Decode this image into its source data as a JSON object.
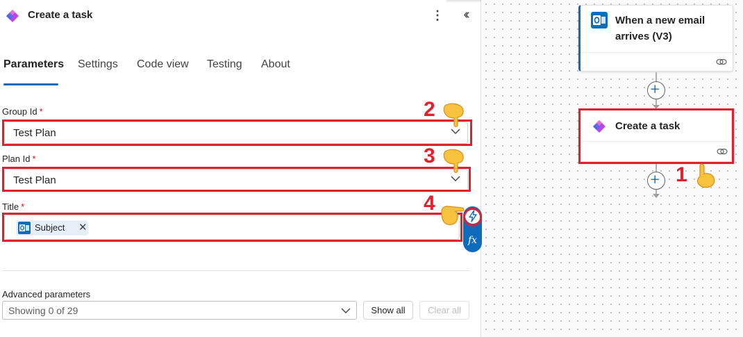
{
  "panel": {
    "title": "Create a task",
    "more_icon": "more-vertical-icon",
    "collapse_icon": "double-chevron-left-icon",
    "tabs": [
      {
        "label": "Parameters",
        "active": true
      },
      {
        "label": "Settings",
        "active": false
      },
      {
        "label": "Code view",
        "active": false
      },
      {
        "label": "Testing",
        "active": false
      },
      {
        "label": "About",
        "active": false
      }
    ],
    "fields": {
      "group_id": {
        "label": "Group Id",
        "required_mark": "*",
        "value": "Test Plan"
      },
      "plan_id": {
        "label": "Plan Id",
        "required_mark": "*",
        "value": "Test Plan"
      },
      "title": {
        "label": "Title",
        "required_mark": "*",
        "token_label": "Subject",
        "token_close": "✕"
      }
    },
    "side_tools": {
      "dynamic_content_icon": "lightning-icon",
      "expression_label": "fx"
    },
    "advanced": {
      "label": "Advanced parameters",
      "select_value": "Showing 0 of 29",
      "show_all": "Show all",
      "clear_all": "Clear all"
    }
  },
  "annotations": {
    "steps": [
      "1",
      "2",
      "3",
      "4"
    ],
    "highlight_color": "#e0202e"
  },
  "canvas": {
    "trigger_card": {
      "title_line1": "When a new email",
      "title_line2": "arrives (V3)"
    },
    "action_card": {
      "title": "Create a task"
    },
    "add_icon": "plus-circle-icon",
    "link_icon": "link-icon"
  },
  "colors": {
    "accent": "#0f6cbd",
    "required": "#c50f1f",
    "annotation": "#e0202e"
  }
}
